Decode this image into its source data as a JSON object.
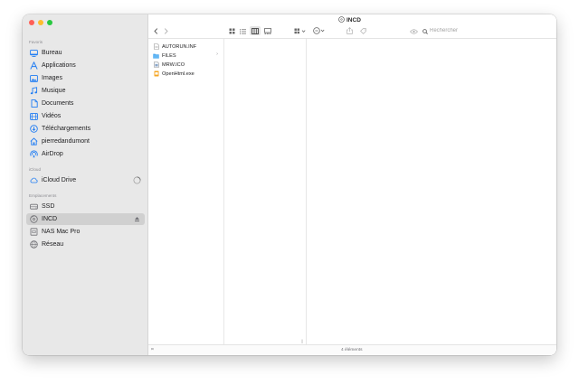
{
  "window": {
    "title": "INCD"
  },
  "sidebar": {
    "sections": [
      {
        "title": "Favoris",
        "items": [
          {
            "label": "Bureau",
            "icon": "desktop-icon"
          },
          {
            "label": "Applications",
            "icon": "applications-icon"
          },
          {
            "label": "Images",
            "icon": "photos-icon"
          },
          {
            "label": "Musique",
            "icon": "music-note-icon"
          },
          {
            "label": "Documents",
            "icon": "document-icon"
          },
          {
            "label": "Vidéos",
            "icon": "film-icon"
          },
          {
            "label": "Téléchargements",
            "icon": "download-icon"
          },
          {
            "label": "pierredandumont",
            "icon": "home-icon"
          },
          {
            "label": "AirDrop",
            "icon": "airdrop-icon"
          }
        ]
      },
      {
        "title": "iCloud",
        "items": [
          {
            "label": "iCloud Drive",
            "icon": "cloud-icon"
          }
        ]
      },
      {
        "title": "Emplacements",
        "items": [
          {
            "label": "SSD",
            "icon": "hard-drive-icon"
          },
          {
            "label": "INCD",
            "icon": "disc-icon",
            "selected": true
          },
          {
            "label": "NAS Mac Pro",
            "icon": "server-icon"
          },
          {
            "label": "Réseau",
            "icon": "network-globe-icon"
          }
        ]
      }
    ]
  },
  "toolbar": {
    "search_placeholder": "Rechercher"
  },
  "files": [
    {
      "name": "AUTORUN.INF",
      "icon": "text-file-icon"
    },
    {
      "name": "FILES",
      "icon": "folder-icon",
      "has_children": true
    },
    {
      "name": "MRW.ICO",
      "icon": "image-file-icon"
    },
    {
      "name": "OpenHtml.exe",
      "icon": "executable-file-icon"
    }
  ],
  "status": {
    "item_count": "4 éléments"
  },
  "colors": {
    "sidebar_accent": "#1f7cf3",
    "folder_blue": "#49a6ee",
    "sidebar_bg": "#e8e8e8",
    "selection_bg": "#d0d0d0"
  }
}
